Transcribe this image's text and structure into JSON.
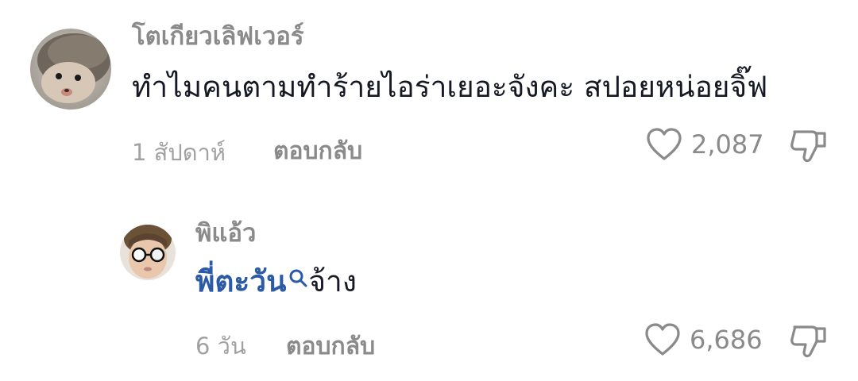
{
  "comments": [
    {
      "username": "โตเกียวเลิฟเวอร์",
      "text": "ทำไมคนตามทำร้ายไอร่าเยอะจังคะ สปอยหน่อยจิ๊ฟ",
      "time": "1 สัปดาห์",
      "reply_label": "ตอบกลับ",
      "likes": "2,087",
      "avatar_icon": "hedgehog-avatar-photo"
    }
  ],
  "replies": [
    {
      "username": "พิแอ้ว",
      "mention": "พี่ตะวัน",
      "text": "จ้าง",
      "time": "6 วัน",
      "reply_label": "ตอบกลับ",
      "likes": "6,686",
      "avatar_icon": "person-with-glasses-avatar-photo"
    }
  ],
  "icons": {
    "like": "heart-outline-icon",
    "dislike": "thumbs-down-outline-icon",
    "mention_search": "search-icon"
  },
  "colors": {
    "username": "#8a8a8a",
    "body_text": "#161823",
    "mention": "#2b5aa6",
    "meta": "#a1a1a1"
  }
}
